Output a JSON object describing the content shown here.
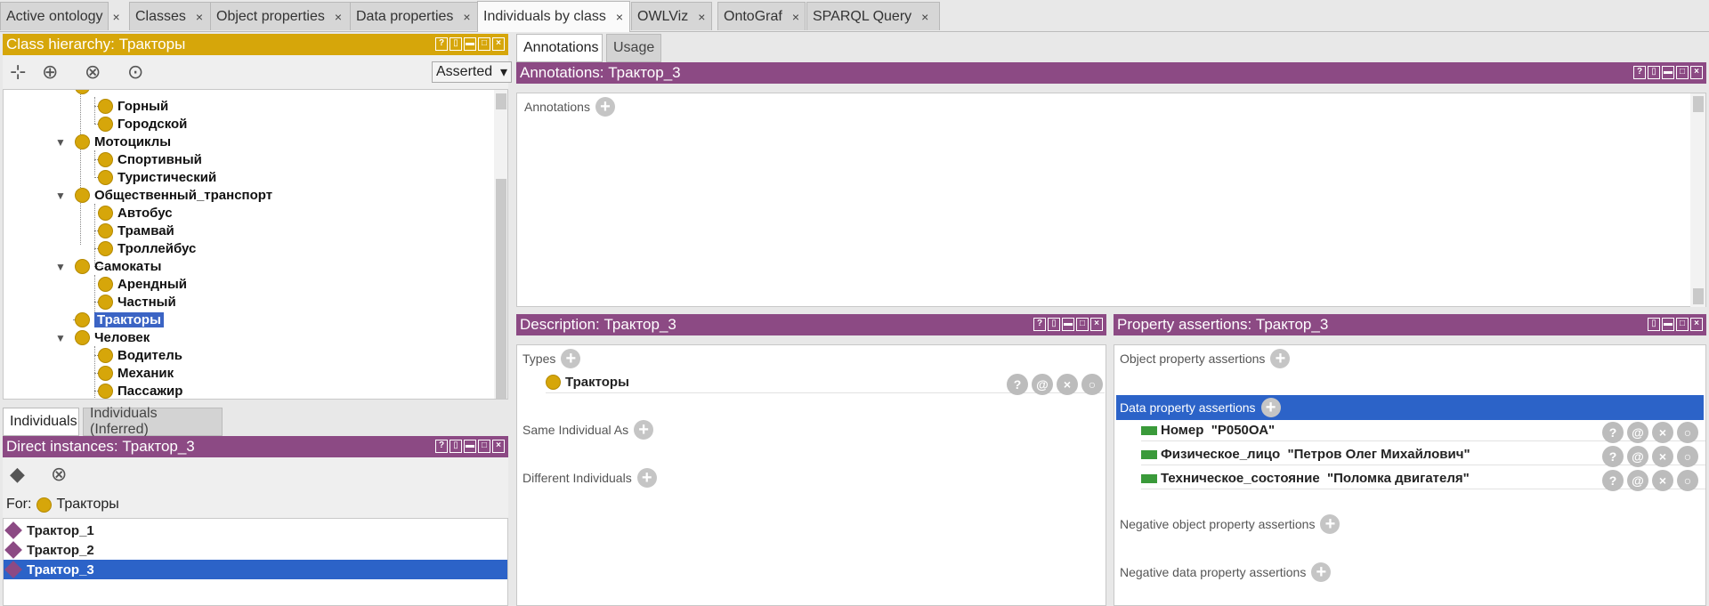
{
  "tabs": [
    {
      "label": "Active ontology"
    },
    {
      "label": "Classes"
    },
    {
      "label": "Object properties"
    },
    {
      "label": "Data properties"
    },
    {
      "label": "Individuals by class"
    },
    {
      "label": "OWLViz"
    },
    {
      "label": "OntoGraf"
    },
    {
      "label": "SPARQL Query"
    }
  ],
  "tab_close": "×",
  "active_tab": "Individuals by class",
  "class_hierarchy": {
    "title": "Class hierarchy: Тракторы",
    "mode": "Asserted",
    "items": [
      {
        "label": "Горный"
      },
      {
        "label": "Городской"
      },
      {
        "label": "Мотоциклы"
      },
      {
        "label": "Спортивный"
      },
      {
        "label": "Туристический"
      },
      {
        "label": "Общественный_транспорт"
      },
      {
        "label": "Автобус"
      },
      {
        "label": "Трамвай"
      },
      {
        "label": "Троллейбус"
      },
      {
        "label": "Самокаты"
      },
      {
        "label": "Арендный"
      },
      {
        "label": "Частный"
      },
      {
        "label": "Тракторы"
      },
      {
        "label": "Человек"
      },
      {
        "label": "Водитель"
      },
      {
        "label": "Механик"
      },
      {
        "label": "Пассажир"
      }
    ],
    "selected": "Тракторы"
  },
  "individuals": {
    "tabs": [
      "Individuals",
      "Individuals (Inferred)"
    ],
    "title": "Direct instances: Трактор_3",
    "for_label": "For:",
    "for_class": "Тракторы",
    "items": [
      "Трактор_1",
      "Трактор_2",
      "Трактор_3"
    ],
    "selected": "Трактор_3"
  },
  "right_tabs": [
    "Annotations",
    "Usage"
  ],
  "annotations": {
    "title": "Annotations: Трактор_3",
    "label": "Annotations"
  },
  "description": {
    "title": "Description: Трактор_3",
    "types_label": "Types",
    "types": [
      "Тракторы"
    ],
    "same_label": "Same Individual As",
    "different_label": "Different Individuals"
  },
  "property_assertions": {
    "title": "Property assertions: Трактор_3",
    "object_label": "Object property assertions",
    "data_label": "Data property assertions",
    "data_items": [
      {
        "prop": "Номер",
        "value": "\"Р050ОА\""
      },
      {
        "prop": "Физическое_лицо",
        "value": "\"Петров Олег Михайлович\""
      },
      {
        "prop": "Техническое_состояние",
        "value": "\"Поломка двигателя\""
      }
    ],
    "neg_object_label": "Negative object property assertions",
    "neg_data_label": "Negative data property assertions"
  },
  "colors": {
    "class_header": "#d6a60a",
    "view_header": "#8c4a84",
    "selection": "#2c63c8"
  },
  "icons": {
    "row_help": "?",
    "row_annotate": "@",
    "row_delete": "×",
    "row_edit": "○"
  }
}
